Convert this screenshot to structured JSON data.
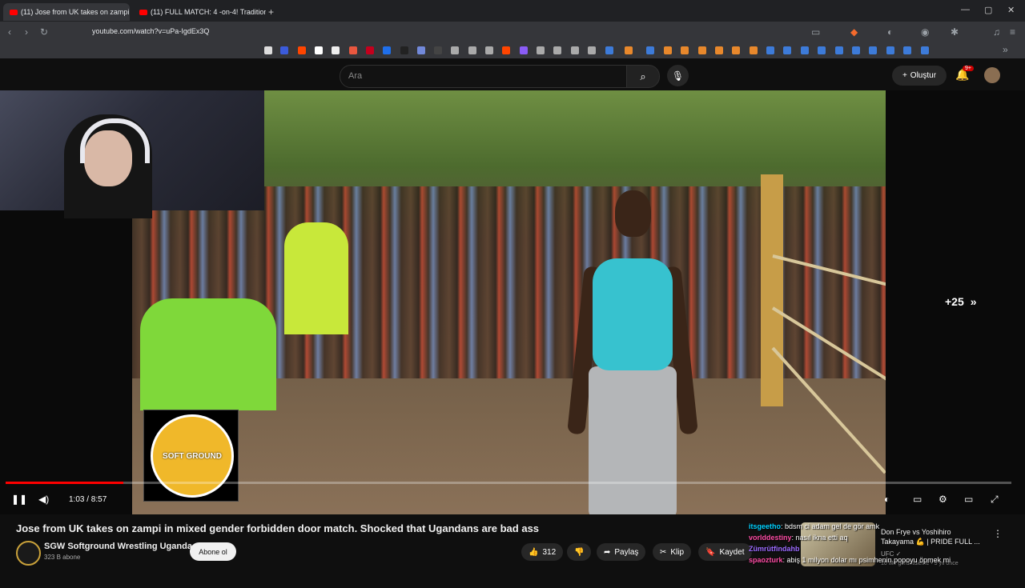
{
  "browser": {
    "tabs": [
      {
        "label": "(11) Jose from UK takes on zampi",
        "active": true
      },
      {
        "label": "(11) FULL MATCH: 4 -on-4! Traditional",
        "active": false
      }
    ],
    "new_tab": "+",
    "url": "youtube.com/watch?v=uPa-IgdEx3Q",
    "window_controls": [
      "—",
      "▢",
      "✕"
    ]
  },
  "youtube": {
    "search_placeholder": "Ara",
    "create_label": "Oluştur",
    "notifications_badge": "9+"
  },
  "player": {
    "skip_label": "+25",
    "time": "1:03 / 8:57",
    "progress_fraction": 0.117,
    "logo_text": "SOFT GROUND"
  },
  "video": {
    "title": "Jose from UK takes on zampi in mixed gender forbidden door match. Shocked that Ugandans are bad ass",
    "channel": "SGW Softground Wrestling Uganda",
    "subscribers": "323 B abone",
    "subscribe_label": "Abone ol",
    "likes": "312",
    "share_label": "Paylaş",
    "clip_label": "Klip",
    "save_label": "Kaydet"
  },
  "chat": [
    {
      "user": "itsgeetho",
      "message": "bdsm ci adam gel de gör amk",
      "color": "#00d1ff"
    },
    {
      "user": "vorlddestiny",
      "message": "nasıl ikna etti aq",
      "color": "#ff4da6"
    },
    {
      "user": "Zümrütfindahb",
      "message": "",
      "color": "#9c6bff"
    },
    {
      "user": "spaozturk",
      "message": "abiş 1 milyon dolar mı psimhenin popoyu öpmek mi",
      "color": "#ff4da6"
    }
  ],
  "recommendation": {
    "title": "Don Frye vs Yoshihiro Takayama 💪 | PRIDE FULL ...",
    "channel": "UFC ✓",
    "meta": "10 Mn görüntüleme • 5 yıl önce"
  }
}
